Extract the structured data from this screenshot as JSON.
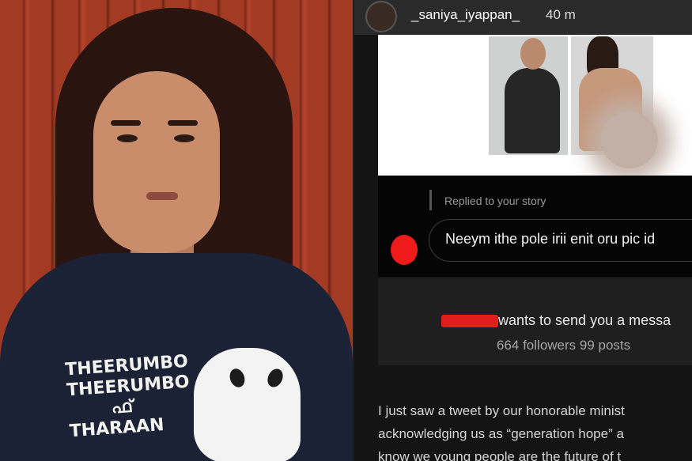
{
  "story": {
    "username": "_saniya_iyappan_",
    "time": "40 m",
    "replied_label": "Replied to your story",
    "reply_message": "Neeym ithe pole irii enit oru  pic id",
    "request_text": "wants to send you a messa",
    "request_stats": "664 followers 99 posts",
    "post_lines": [
      "I just saw a tweet by our honorable minist",
      "acknowledging us as “generation hope” a",
      "know we young people are the future of t"
    ]
  },
  "photo": {
    "shirt_print_lines": [
      "THEERUMBO",
      "THEERUMBO",
      "ഫ്",
      "THARAAN"
    ]
  },
  "colors": {
    "story_bg": "#141414",
    "redaction": "#e11d1d",
    "wall": "#a23a24",
    "shirt": "#1c2236"
  }
}
